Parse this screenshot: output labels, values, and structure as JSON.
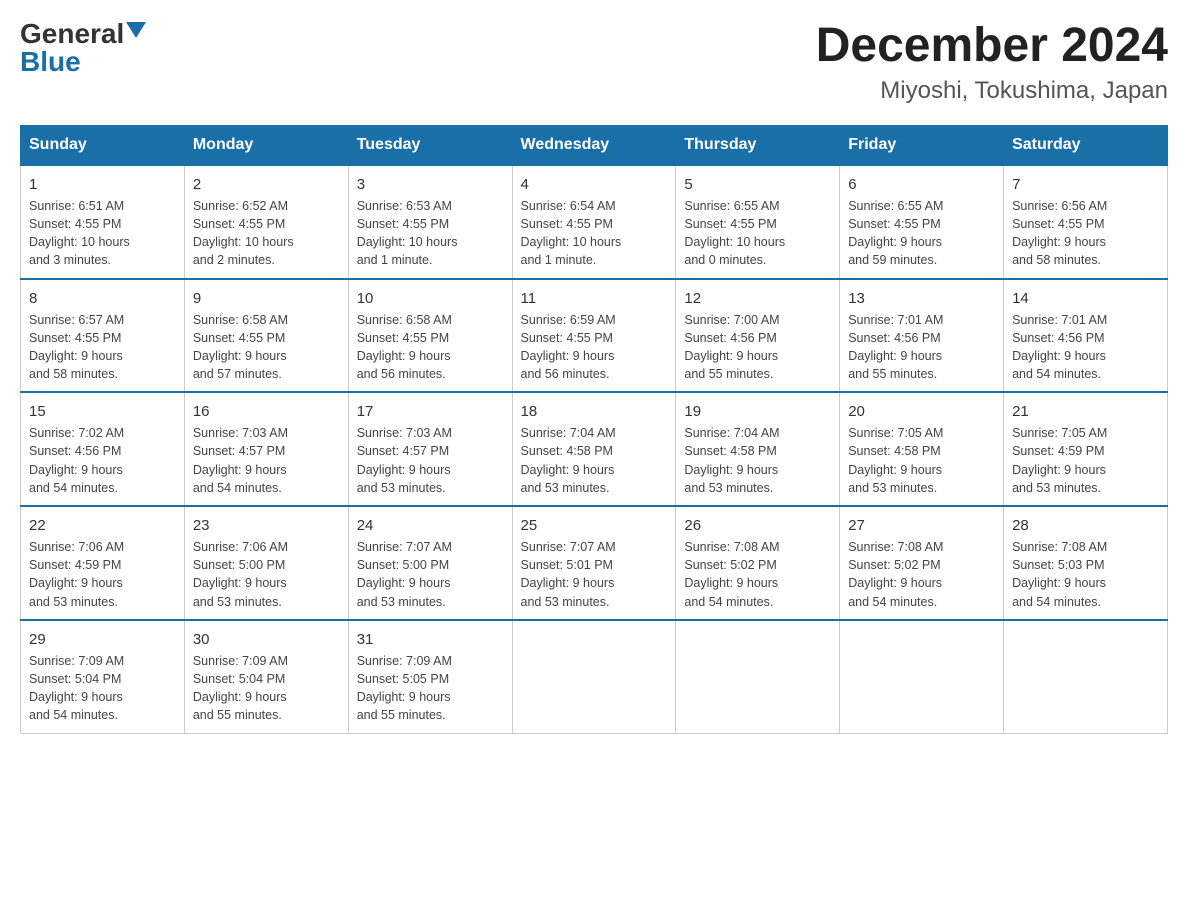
{
  "logo": {
    "general": "General",
    "blue": "Blue"
  },
  "title": "December 2024",
  "subtitle": "Miyoshi, Tokushima, Japan",
  "days_of_week": [
    "Sunday",
    "Monday",
    "Tuesday",
    "Wednesday",
    "Thursday",
    "Friday",
    "Saturday"
  ],
  "weeks": [
    [
      {
        "num": "1",
        "sunrise": "6:51 AM",
        "sunset": "4:55 PM",
        "daylight": "10 hours and 3 minutes."
      },
      {
        "num": "2",
        "sunrise": "6:52 AM",
        "sunset": "4:55 PM",
        "daylight": "10 hours and 2 minutes."
      },
      {
        "num": "3",
        "sunrise": "6:53 AM",
        "sunset": "4:55 PM",
        "daylight": "10 hours and 1 minute."
      },
      {
        "num": "4",
        "sunrise": "6:54 AM",
        "sunset": "4:55 PM",
        "daylight": "10 hours and 1 minute."
      },
      {
        "num": "5",
        "sunrise": "6:55 AM",
        "sunset": "4:55 PM",
        "daylight": "10 hours and 0 minutes."
      },
      {
        "num": "6",
        "sunrise": "6:55 AM",
        "sunset": "4:55 PM",
        "daylight": "9 hours and 59 minutes."
      },
      {
        "num": "7",
        "sunrise": "6:56 AM",
        "sunset": "4:55 PM",
        "daylight": "9 hours and 58 minutes."
      }
    ],
    [
      {
        "num": "8",
        "sunrise": "6:57 AM",
        "sunset": "4:55 PM",
        "daylight": "9 hours and 58 minutes."
      },
      {
        "num": "9",
        "sunrise": "6:58 AM",
        "sunset": "4:55 PM",
        "daylight": "9 hours and 57 minutes."
      },
      {
        "num": "10",
        "sunrise": "6:58 AM",
        "sunset": "4:55 PM",
        "daylight": "9 hours and 56 minutes."
      },
      {
        "num": "11",
        "sunrise": "6:59 AM",
        "sunset": "4:55 PM",
        "daylight": "9 hours and 56 minutes."
      },
      {
        "num": "12",
        "sunrise": "7:00 AM",
        "sunset": "4:56 PM",
        "daylight": "9 hours and 55 minutes."
      },
      {
        "num": "13",
        "sunrise": "7:01 AM",
        "sunset": "4:56 PM",
        "daylight": "9 hours and 55 minutes."
      },
      {
        "num": "14",
        "sunrise": "7:01 AM",
        "sunset": "4:56 PM",
        "daylight": "9 hours and 54 minutes."
      }
    ],
    [
      {
        "num": "15",
        "sunrise": "7:02 AM",
        "sunset": "4:56 PM",
        "daylight": "9 hours and 54 minutes."
      },
      {
        "num": "16",
        "sunrise": "7:03 AM",
        "sunset": "4:57 PM",
        "daylight": "9 hours and 54 minutes."
      },
      {
        "num": "17",
        "sunrise": "7:03 AM",
        "sunset": "4:57 PM",
        "daylight": "9 hours and 53 minutes."
      },
      {
        "num": "18",
        "sunrise": "7:04 AM",
        "sunset": "4:58 PM",
        "daylight": "9 hours and 53 minutes."
      },
      {
        "num": "19",
        "sunrise": "7:04 AM",
        "sunset": "4:58 PM",
        "daylight": "9 hours and 53 minutes."
      },
      {
        "num": "20",
        "sunrise": "7:05 AM",
        "sunset": "4:58 PM",
        "daylight": "9 hours and 53 minutes."
      },
      {
        "num": "21",
        "sunrise": "7:05 AM",
        "sunset": "4:59 PM",
        "daylight": "9 hours and 53 minutes."
      }
    ],
    [
      {
        "num": "22",
        "sunrise": "7:06 AM",
        "sunset": "4:59 PM",
        "daylight": "9 hours and 53 minutes."
      },
      {
        "num": "23",
        "sunrise": "7:06 AM",
        "sunset": "5:00 PM",
        "daylight": "9 hours and 53 minutes."
      },
      {
        "num": "24",
        "sunrise": "7:07 AM",
        "sunset": "5:00 PM",
        "daylight": "9 hours and 53 minutes."
      },
      {
        "num": "25",
        "sunrise": "7:07 AM",
        "sunset": "5:01 PM",
        "daylight": "9 hours and 53 minutes."
      },
      {
        "num": "26",
        "sunrise": "7:08 AM",
        "sunset": "5:02 PM",
        "daylight": "9 hours and 54 minutes."
      },
      {
        "num": "27",
        "sunrise": "7:08 AM",
        "sunset": "5:02 PM",
        "daylight": "9 hours and 54 minutes."
      },
      {
        "num": "28",
        "sunrise": "7:08 AM",
        "sunset": "5:03 PM",
        "daylight": "9 hours and 54 minutes."
      }
    ],
    [
      {
        "num": "29",
        "sunrise": "7:09 AM",
        "sunset": "5:04 PM",
        "daylight": "9 hours and 54 minutes."
      },
      {
        "num": "30",
        "sunrise": "7:09 AM",
        "sunset": "5:04 PM",
        "daylight": "9 hours and 55 minutes."
      },
      {
        "num": "31",
        "sunrise": "7:09 AM",
        "sunset": "5:05 PM",
        "daylight": "9 hours and 55 minutes."
      },
      null,
      null,
      null,
      null
    ]
  ],
  "labels": {
    "sunrise": "Sunrise:",
    "sunset": "Sunset:",
    "daylight": "Daylight:"
  }
}
